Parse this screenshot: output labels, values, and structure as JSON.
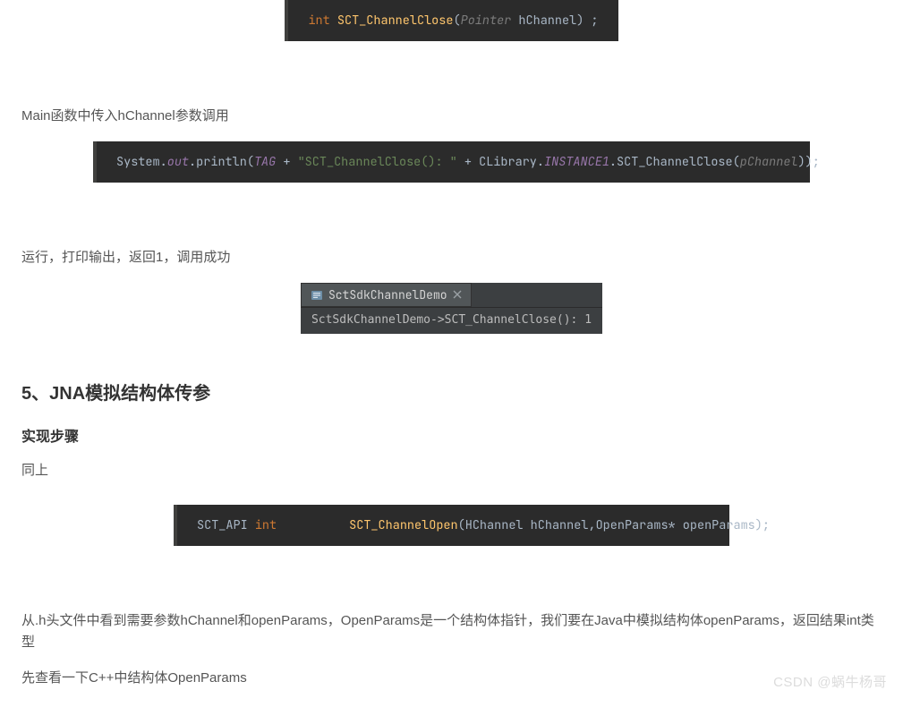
{
  "code1": {
    "t_int": "int",
    "t_fn": "SCT_ChannelClose",
    "t_ptr": "Pointer",
    "t_arg": "hChannel",
    "t_end": " ;"
  },
  "para1": "Main函数中传入hChannel参数调用",
  "code2": {
    "t_sys": "System",
    "t_dot1": ".",
    "t_out": "out",
    "t_dot2": ".",
    "t_println": "println",
    "t_open": "(",
    "t_tag": "TAG",
    "t_plus1": " + ",
    "t_str": "\"SCT_ChannelClose(): \"",
    "t_plus2": " + ",
    "t_clib": "CLibrary",
    "t_dot3": ".",
    "t_inst": "INSTANCE1",
    "t_dot4": ".",
    "t_call": "SCT_ChannelClose",
    "t_po": "(",
    "t_pch": "pChannel",
    "t_pc": ")",
    "t_close": ");"
  },
  "para2": "运行，打印输出，返回1，调用成功",
  "console": {
    "tab_label": "SctSdkChannelDemo",
    "output": "SctSdkChannelDemo->SCT_ChannelClose(): 1"
  },
  "heading_5": "5、JNA模拟结构体传参",
  "heading_steps": "实现步骤",
  "para3": "同上",
  "code3": {
    "t_api": "SCT_API ",
    "t_int": "int",
    "t_space": "          ",
    "t_fn": "SCT_ChannelOpen",
    "t_open": "(",
    "t_h1": "HChannel ",
    "t_a1": "hChannel",
    "t_c": ",",
    "t_h2": "OpenParams* ",
    "t_a2": "openParams",
    "t_close": ");"
  },
  "para4": "从.h头文件中看到需要参数hChannel和openParams，OpenParams是一个结构体指针，我们要在Java中模拟结构体openParams，返回结果int类型",
  "para5": "先查看一下C++中结构体OpenParams",
  "watermark": "CSDN @蜗牛杨哥"
}
